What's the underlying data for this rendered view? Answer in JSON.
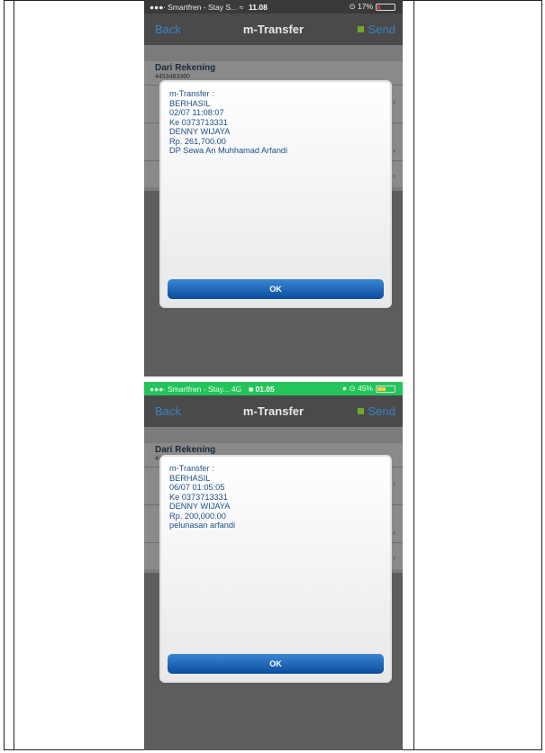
{
  "screens": [
    {
      "status": {
        "carrier": "●●●∙ Smartfren - Stay S... ≈",
        "time": "11.08",
        "battery": "⊙ 17%",
        "battery_fill_fraction": 0.17,
        "battery_color": "#d33b3b"
      },
      "nav": {
        "back": "Back",
        "title": "m-Transfer",
        "send": "Send"
      },
      "form": {
        "label": "Dari Rekening",
        "account": "4453483360"
      },
      "dialog": {
        "lines": [
          "m-Transfer :",
          "BERHASIL",
          "02/07 11:08:07",
          "Ke 0373713331",
          "DENNY WIJAYA",
          "Rp. 261,700.00",
          "DP Sewa An Muhhamad Arfandi"
        ],
        "ok": "OK"
      }
    },
    {
      "status": {
        "carrier": "●●●∙ Smartfren - Stay...  4G",
        "time": "■ 01.05",
        "battery": "● ⊙ 45%",
        "battery_fill_fraction": 0.45,
        "battery_color": "#ffd23a",
        "status_bg": "#23c45b"
      },
      "nav": {
        "back": "Back",
        "title": "m-Transfer",
        "send": "Send"
      },
      "form": {
        "label": "Dari Rekening",
        "account": "4453483360"
      },
      "dialog": {
        "lines": [
          "m-Transfer :",
          "BERHASIL",
          "06/07 01:05:05",
          "Ke 0373713331",
          "DENNY WIJAYA",
          "Rp. 200,000.00",
          "pelunasan arfandi"
        ],
        "ok": "OK"
      }
    }
  ]
}
